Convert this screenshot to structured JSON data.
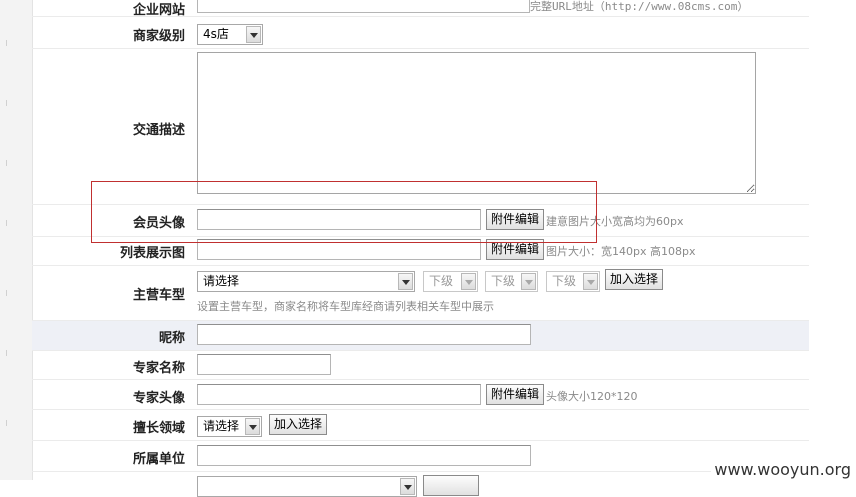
{
  "form": {
    "website": {
      "label": "企业网站",
      "hint": "完整URL地址（http://www.08cms.com）"
    },
    "level": {
      "label": "商家级别",
      "selected": "4s店"
    },
    "traffic": {
      "label": "交通描述"
    },
    "avatar": {
      "label": "会员头像",
      "button": "附件编辑",
      "hint": "建意图片大小宽高均为60px"
    },
    "list_image": {
      "label": "列表展示图",
      "button": "附件编辑",
      "hint": "图片大小：宽140px 高108px"
    },
    "main_models": {
      "label": "主营车型",
      "select1": "请选择",
      "select2": "下级",
      "select3": "下级",
      "select4": "下级",
      "add_button": "加入选择",
      "note": "设置主营车型，商家名称将车型库经商请列表相关车型中展示"
    },
    "nickname": {
      "label": "昵称"
    },
    "expert_name": {
      "label": "专家名称"
    },
    "expert_avatar": {
      "label": "专家头像",
      "button": "附件编辑",
      "hint": "头像大小120*120"
    },
    "expertise": {
      "label": "擅长领域",
      "selected": "请选择",
      "add_button": "加入选择"
    },
    "unit": {
      "label": "所属单位"
    }
  },
  "watermark": "www.wooyun.org",
  "colors": {
    "highlight_box": "#c03030",
    "alt_row": "#eef0f6"
  }
}
